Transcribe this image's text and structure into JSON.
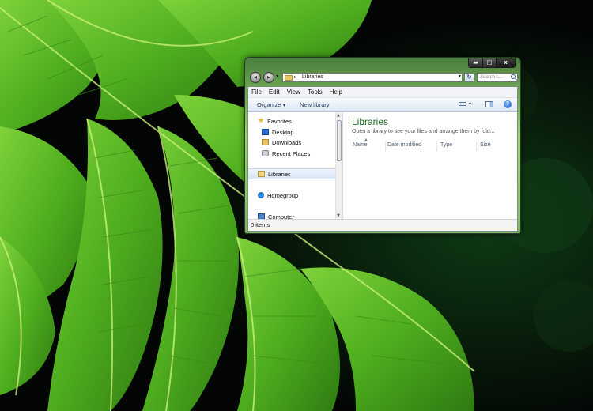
{
  "window": {
    "controls": {
      "minimize": "▬",
      "maximize": "□",
      "close": "x"
    }
  },
  "address_bar": {
    "path_separator": "▸",
    "path": "Libraries",
    "search_placeholder": "Search L..."
  },
  "menu": [
    "File",
    "Edit",
    "View",
    "Tools",
    "Help"
  ],
  "toolbar": {
    "organize": "Organize ▾",
    "new_library": "New library",
    "help": "?"
  },
  "nav": {
    "favorites": "Favorites",
    "desktop": "Desktop",
    "downloads": "Downloads",
    "recent_places": "Recent Places",
    "libraries": "Libraries",
    "homegroup": "Homegroup",
    "computer": "Computer"
  },
  "content": {
    "title": "Libraries",
    "subtitle": "Open a library to see your files and arrange them by fold...",
    "columns": [
      "Name",
      "Date modified",
      "Type",
      "Size"
    ]
  },
  "status": {
    "items": "0 items"
  },
  "colors": {
    "title_green": "#1e6e1e",
    "toolbar_text": "#1e395b",
    "frame_green": "#9bd278"
  }
}
